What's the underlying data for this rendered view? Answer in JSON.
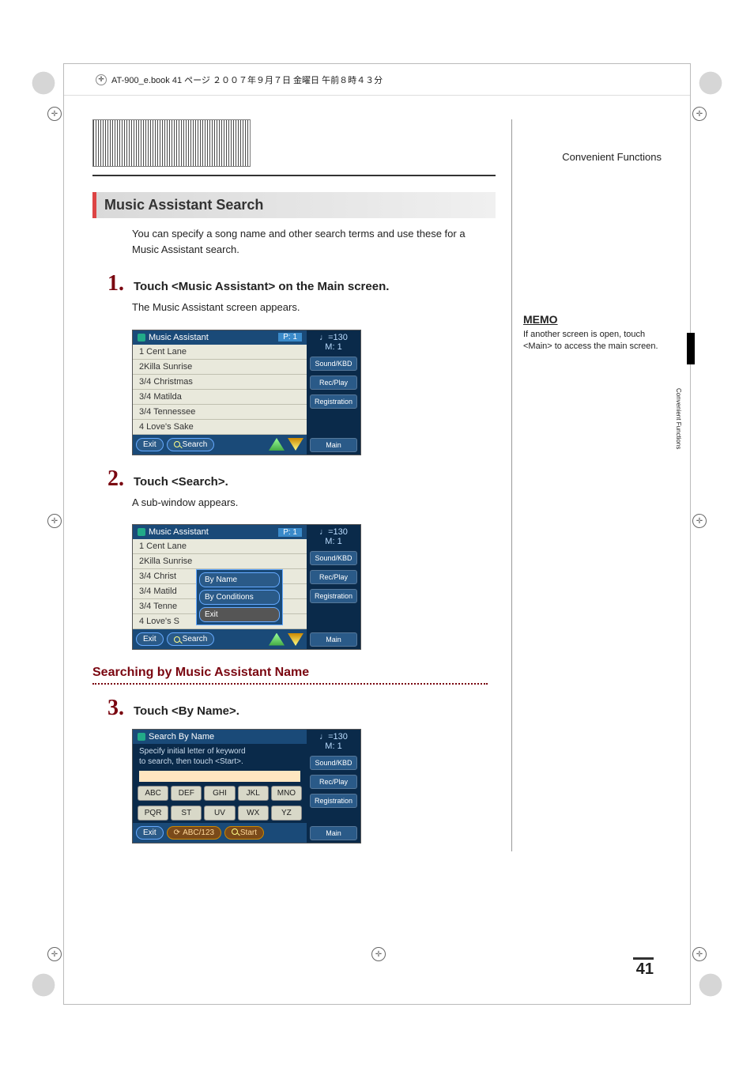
{
  "header": {
    "meta": "AT-900_e.book  41 ページ  ２００７年９月７日 金曜日 午前８時４３分"
  },
  "side": {
    "section_title": "Convenient Functions",
    "memo_label": "MEMO",
    "memo_text": "If another screen is open, touch <Main> to access the main screen.",
    "vertical": "Convenient Functions"
  },
  "h2": "Music Assistant Search",
  "intro": "You can specify a song name and other search terms and use these for a Music Assistant search.",
  "steps": {
    "s1": {
      "num": "1.",
      "title": "Touch <Music Assistant> on the Main screen.",
      "sub": "The Music Assistant screen appears."
    },
    "s2": {
      "num": "2.",
      "title": "Touch <Search>.",
      "sub": "A sub-window appears."
    },
    "s3": {
      "num": "3.",
      "title": "Touch <By Name>."
    }
  },
  "subheading": "Searching by Music Assistant Name",
  "screenshot_common": {
    "title": "Music Assistant",
    "page_ind": "P: 1",
    "tempo": "♩=130",
    "measure": "M:   1",
    "side_buttons": {
      "sound": "Sound/KBD",
      "rec": "Rec/Play",
      "reg": "Registration",
      "main": "Main"
    },
    "exit": "Exit",
    "search": "Search"
  },
  "ss1": {
    "items": [
      "1 Cent Lane",
      "2Killa Sunrise",
      "3/4 Christmas",
      "3/4 Matilda",
      "3/4 Tennessee",
      "4 Love's Sake"
    ]
  },
  "ss2": {
    "items": [
      "1 Cent Lane",
      "2Killa Sunrise",
      "3/4 Christ",
      "3/4 Matild",
      "3/4 Tenne",
      "4 Love's S"
    ],
    "popup": {
      "by_name": "By Name",
      "by_cond": "By Conditions",
      "exit": "Exit"
    }
  },
  "ss3": {
    "title": "Search By Name",
    "instr1": "Specify initial letter of keyword",
    "instr2": "to search, then touch <Start>.",
    "keys_row1": [
      "ABC",
      "DEF",
      "GHI",
      "JKL",
      "MNO"
    ],
    "keys_row2": [
      "PQR",
      "ST",
      "UV",
      "WX",
      "YZ"
    ],
    "abc123": "ABC/123",
    "start": "Start"
  },
  "page_number": "41"
}
